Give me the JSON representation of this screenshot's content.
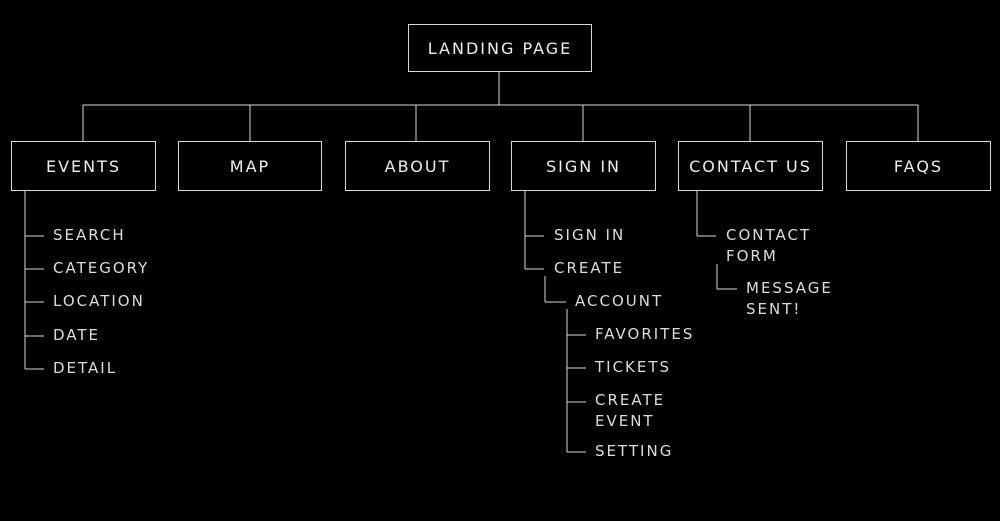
{
  "root": {
    "label": "LANDING PAGE"
  },
  "sections": [
    {
      "label": "EVENTS"
    },
    {
      "label": "MAP"
    },
    {
      "label": "ABOUT"
    },
    {
      "label": "SIGN IN"
    },
    {
      "label": "CONTACT US"
    },
    {
      "label": "FAQS"
    }
  ],
  "events_items": [
    "SEARCH",
    "CATEGORY",
    "LOCATION",
    "DATE",
    "DETAIL"
  ],
  "signin_items": [
    "SIGN IN",
    "CREATE"
  ],
  "account": {
    "label": "ACCOUNT",
    "items": [
      "FAVORITES",
      "TICKETS",
      "CREATE",
      "EVENT",
      "SETTING"
    ]
  },
  "contact_items": {
    "form_line1": "CONTACT",
    "form_line2": "FORM",
    "sent_line1": "MESSAGE",
    "sent_line2": "SENT!"
  },
  "colors": {
    "background": "#000000",
    "line": "#d9d9d9",
    "text": "#e6e6e6"
  }
}
